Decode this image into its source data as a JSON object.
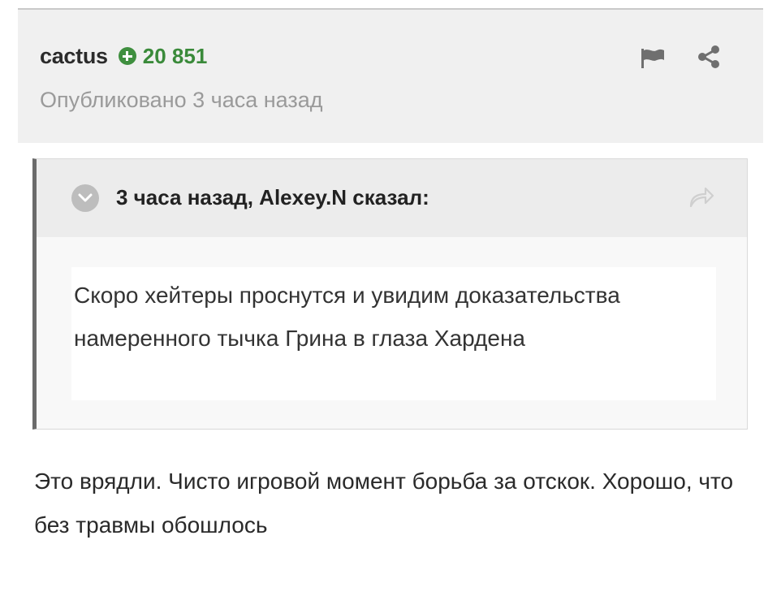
{
  "post": {
    "author": "cactus",
    "reputation": "20 851",
    "published": "Опубликовано 3 часа назад",
    "actions": {
      "report_icon": "flag-icon",
      "share_icon": "share-icon"
    }
  },
  "quote": {
    "citation": "3 часа назад, Alexey.N сказал:",
    "text": "Скоро хейтеры проснутся и увидим доказательства намеренного тычка Грина в глаза Хардена",
    "toggle_icon": "chevron-down-icon",
    "jump_icon": "reply-arrow-icon"
  },
  "reply": {
    "text": "Это врядли. Чисто игровой момент борьба за отскок. Хорошо, что без травмы обошлось"
  },
  "colors": {
    "header_bg": "#f0f0f0",
    "reputation_green": "#3a8a3a",
    "quote_border": "#6a6a6a",
    "muted_text": "#9a9a9a"
  }
}
